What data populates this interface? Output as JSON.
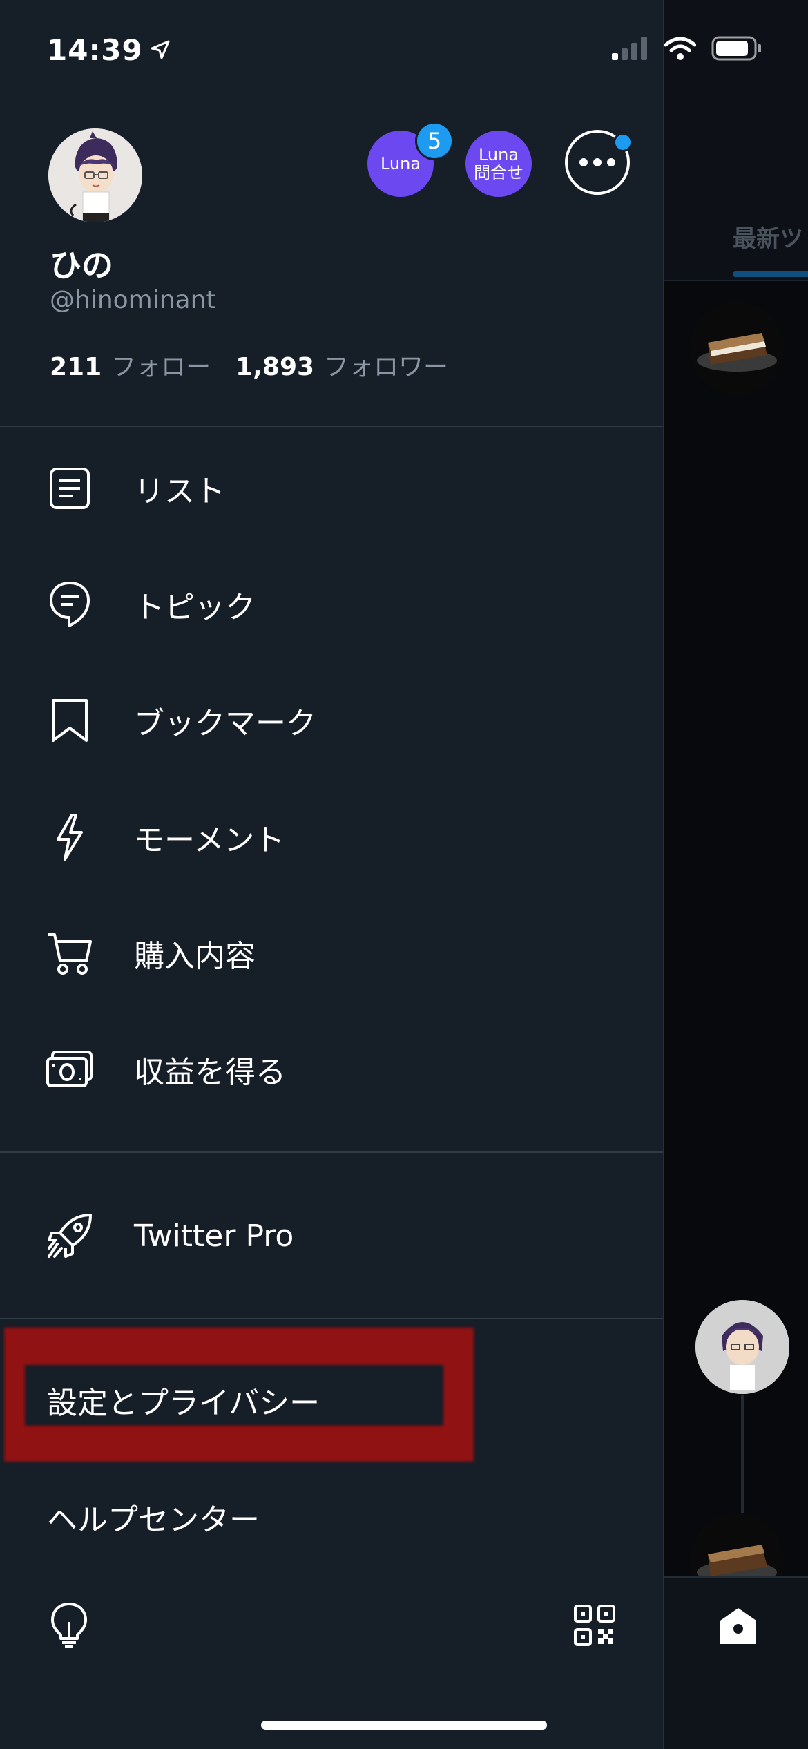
{
  "status_bar": {
    "time": "14:39"
  },
  "profile": {
    "display_name": "ひの",
    "handle": "@hinominant",
    "following_count": "211",
    "following_label": "フォロー",
    "followers_count": "1,893",
    "followers_label": "フォロワー"
  },
  "header_buttons": {
    "luna_label": "Luna",
    "luna_badge": "5",
    "luna_contact_line1": "Luna",
    "luna_contact_line2": "問合せ"
  },
  "menu": {
    "items": [
      {
        "label": "リスト",
        "icon": "list-icon"
      },
      {
        "label": "トピック",
        "icon": "topic-icon"
      },
      {
        "label": "ブックマーク",
        "icon": "bookmark-icon"
      },
      {
        "label": "モーメント",
        "icon": "lightning-icon"
      },
      {
        "label": "購入内容",
        "icon": "cart-icon"
      },
      {
        "label": "収益を得る",
        "icon": "money-icon"
      }
    ],
    "pro": {
      "label": "Twitter Pro",
      "icon": "rocket-icon"
    },
    "settings_label": "設定とプライバシー",
    "help_label": "ヘルプセンター"
  },
  "background": {
    "tab_label": "最新ツ"
  },
  "colors": {
    "drawer_bg": "#161e28",
    "accent_blue": "#1d9bf0",
    "luna_purple": "#6b48f0",
    "highlight_red": "#9c1111",
    "secondary_text": "#8a96a3"
  }
}
